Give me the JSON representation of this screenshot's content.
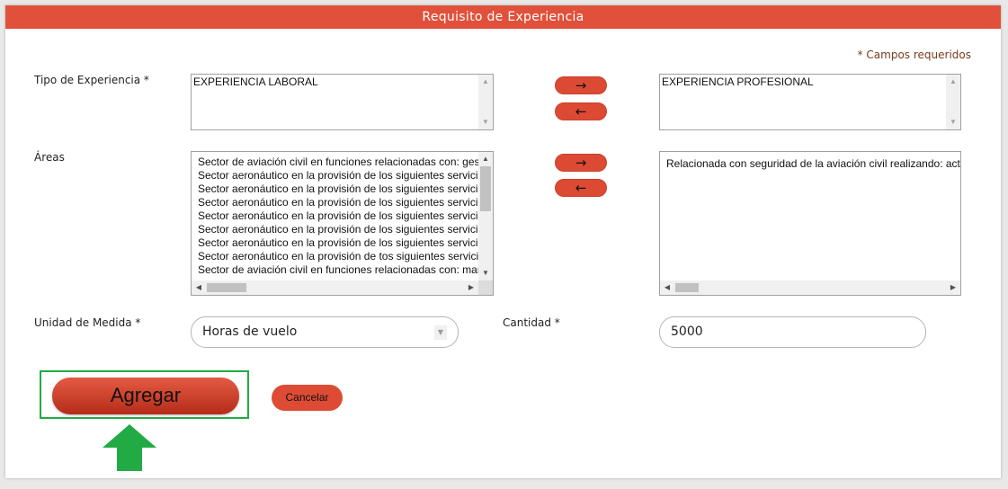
{
  "panel": {
    "title": "Requisito de Experiencia",
    "required_note": "* Campos requeridos"
  },
  "experience_type": {
    "label": "Tipo de Experiencia *",
    "available": [
      "EXPERIENCIA LABORAL"
    ],
    "selected": [
      "EXPERIENCIA PROFESIONAL"
    ],
    "add_icon": "→",
    "remove_icon": "←"
  },
  "areas": {
    "label": "Áreas",
    "available": [
      "Sector de aviación civil en funciones relacionadas con: gestión",
      "Sector aeronáutico en la provisión de los siguientes servicios",
      "Sector aeronáutico en la provisión de los siguientes servicios",
      "Sector aeronáutico en la provisión de los siguientes servicios",
      "Sector aeronáutico en la provisión de los siguientes servicios",
      "Sector aeronáutico en la provisión de los siguientes servicios",
      "Sector aeronáutico en la provisión de los siguientes servicios",
      "Sector aeronáutico en la provisión de tos siguientes servicios",
      "Sector de aviación civil en funciones relacionadas con: mantenimiento"
    ],
    "selected": [
      "Relacionada con seguridad de la aviación civil realizando: actividades"
    ],
    "add_icon": "→",
    "remove_icon": "←"
  },
  "unit": {
    "label": "Unidad de Medida *",
    "value": "Horas de vuelo"
  },
  "quantity": {
    "label": "Cantidad *",
    "value": "5000"
  },
  "actions": {
    "add_label": "Agregar",
    "cancel_label": "Cancelar"
  },
  "colors": {
    "accent": "#e1503a",
    "highlight": "#22aa44"
  }
}
